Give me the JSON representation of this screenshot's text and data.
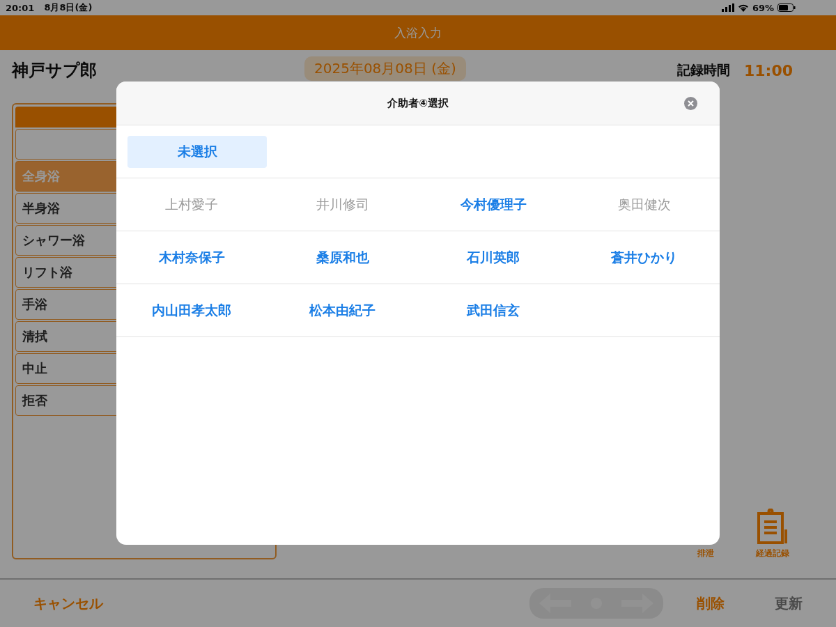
{
  "status_bar": {
    "time": "20:01",
    "date": "8月8日(金)",
    "battery": "69%"
  },
  "header": {
    "title": "入浴入力"
  },
  "resident": {
    "name": "神戸サプ郎"
  },
  "date": "2025年08月08日 (金)",
  "record_time": {
    "label": "記録時間",
    "value": "11:00"
  },
  "bath_types": [
    {
      "label": "全身浴",
      "selected": true
    },
    {
      "label": "半身浴",
      "selected": false
    },
    {
      "label": "シャワー浴",
      "selected": false
    },
    {
      "label": "リフト浴",
      "selected": false
    },
    {
      "label": "手浴",
      "selected": false
    },
    {
      "label": "清拭",
      "selected": false
    },
    {
      "label": "中止",
      "selected": false
    },
    {
      "label": "拒否",
      "selected": false
    }
  ],
  "shortcuts": [
    {
      "label": "排泄",
      "kind": "hidden"
    },
    {
      "label": "経過記録",
      "kind": "clipboard"
    }
  ],
  "footer": {
    "cancel": "キャンセル",
    "delete": "削除",
    "update": {
      "label": "更新",
      "disabled": true
    }
  },
  "dialog": {
    "title": "介助者④選択",
    "none_option": {
      "label": "未選択",
      "selected": true
    },
    "options": [
      {
        "label": "上村愛子",
        "disabled": true,
        "selected": false
      },
      {
        "label": "井川修司",
        "disabled": true,
        "selected": false
      },
      {
        "label": "今村優理子",
        "disabled": false,
        "selected": false
      },
      {
        "label": "奥田健次",
        "disabled": true,
        "selected": false
      },
      {
        "label": "木村奈保子",
        "disabled": false,
        "selected": false
      },
      {
        "label": "桑原和也",
        "disabled": false,
        "selected": false
      },
      {
        "label": "石川英郎",
        "disabled": false,
        "selected": false
      },
      {
        "label": "蒼井ひかり",
        "disabled": false,
        "selected": false
      },
      {
        "label": "内山田孝太郎",
        "disabled": false,
        "selected": false
      },
      {
        "label": "松本由紀子",
        "disabled": false,
        "selected": false
      },
      {
        "label": "武田信玄",
        "disabled": false,
        "selected": false
      }
    ]
  }
}
